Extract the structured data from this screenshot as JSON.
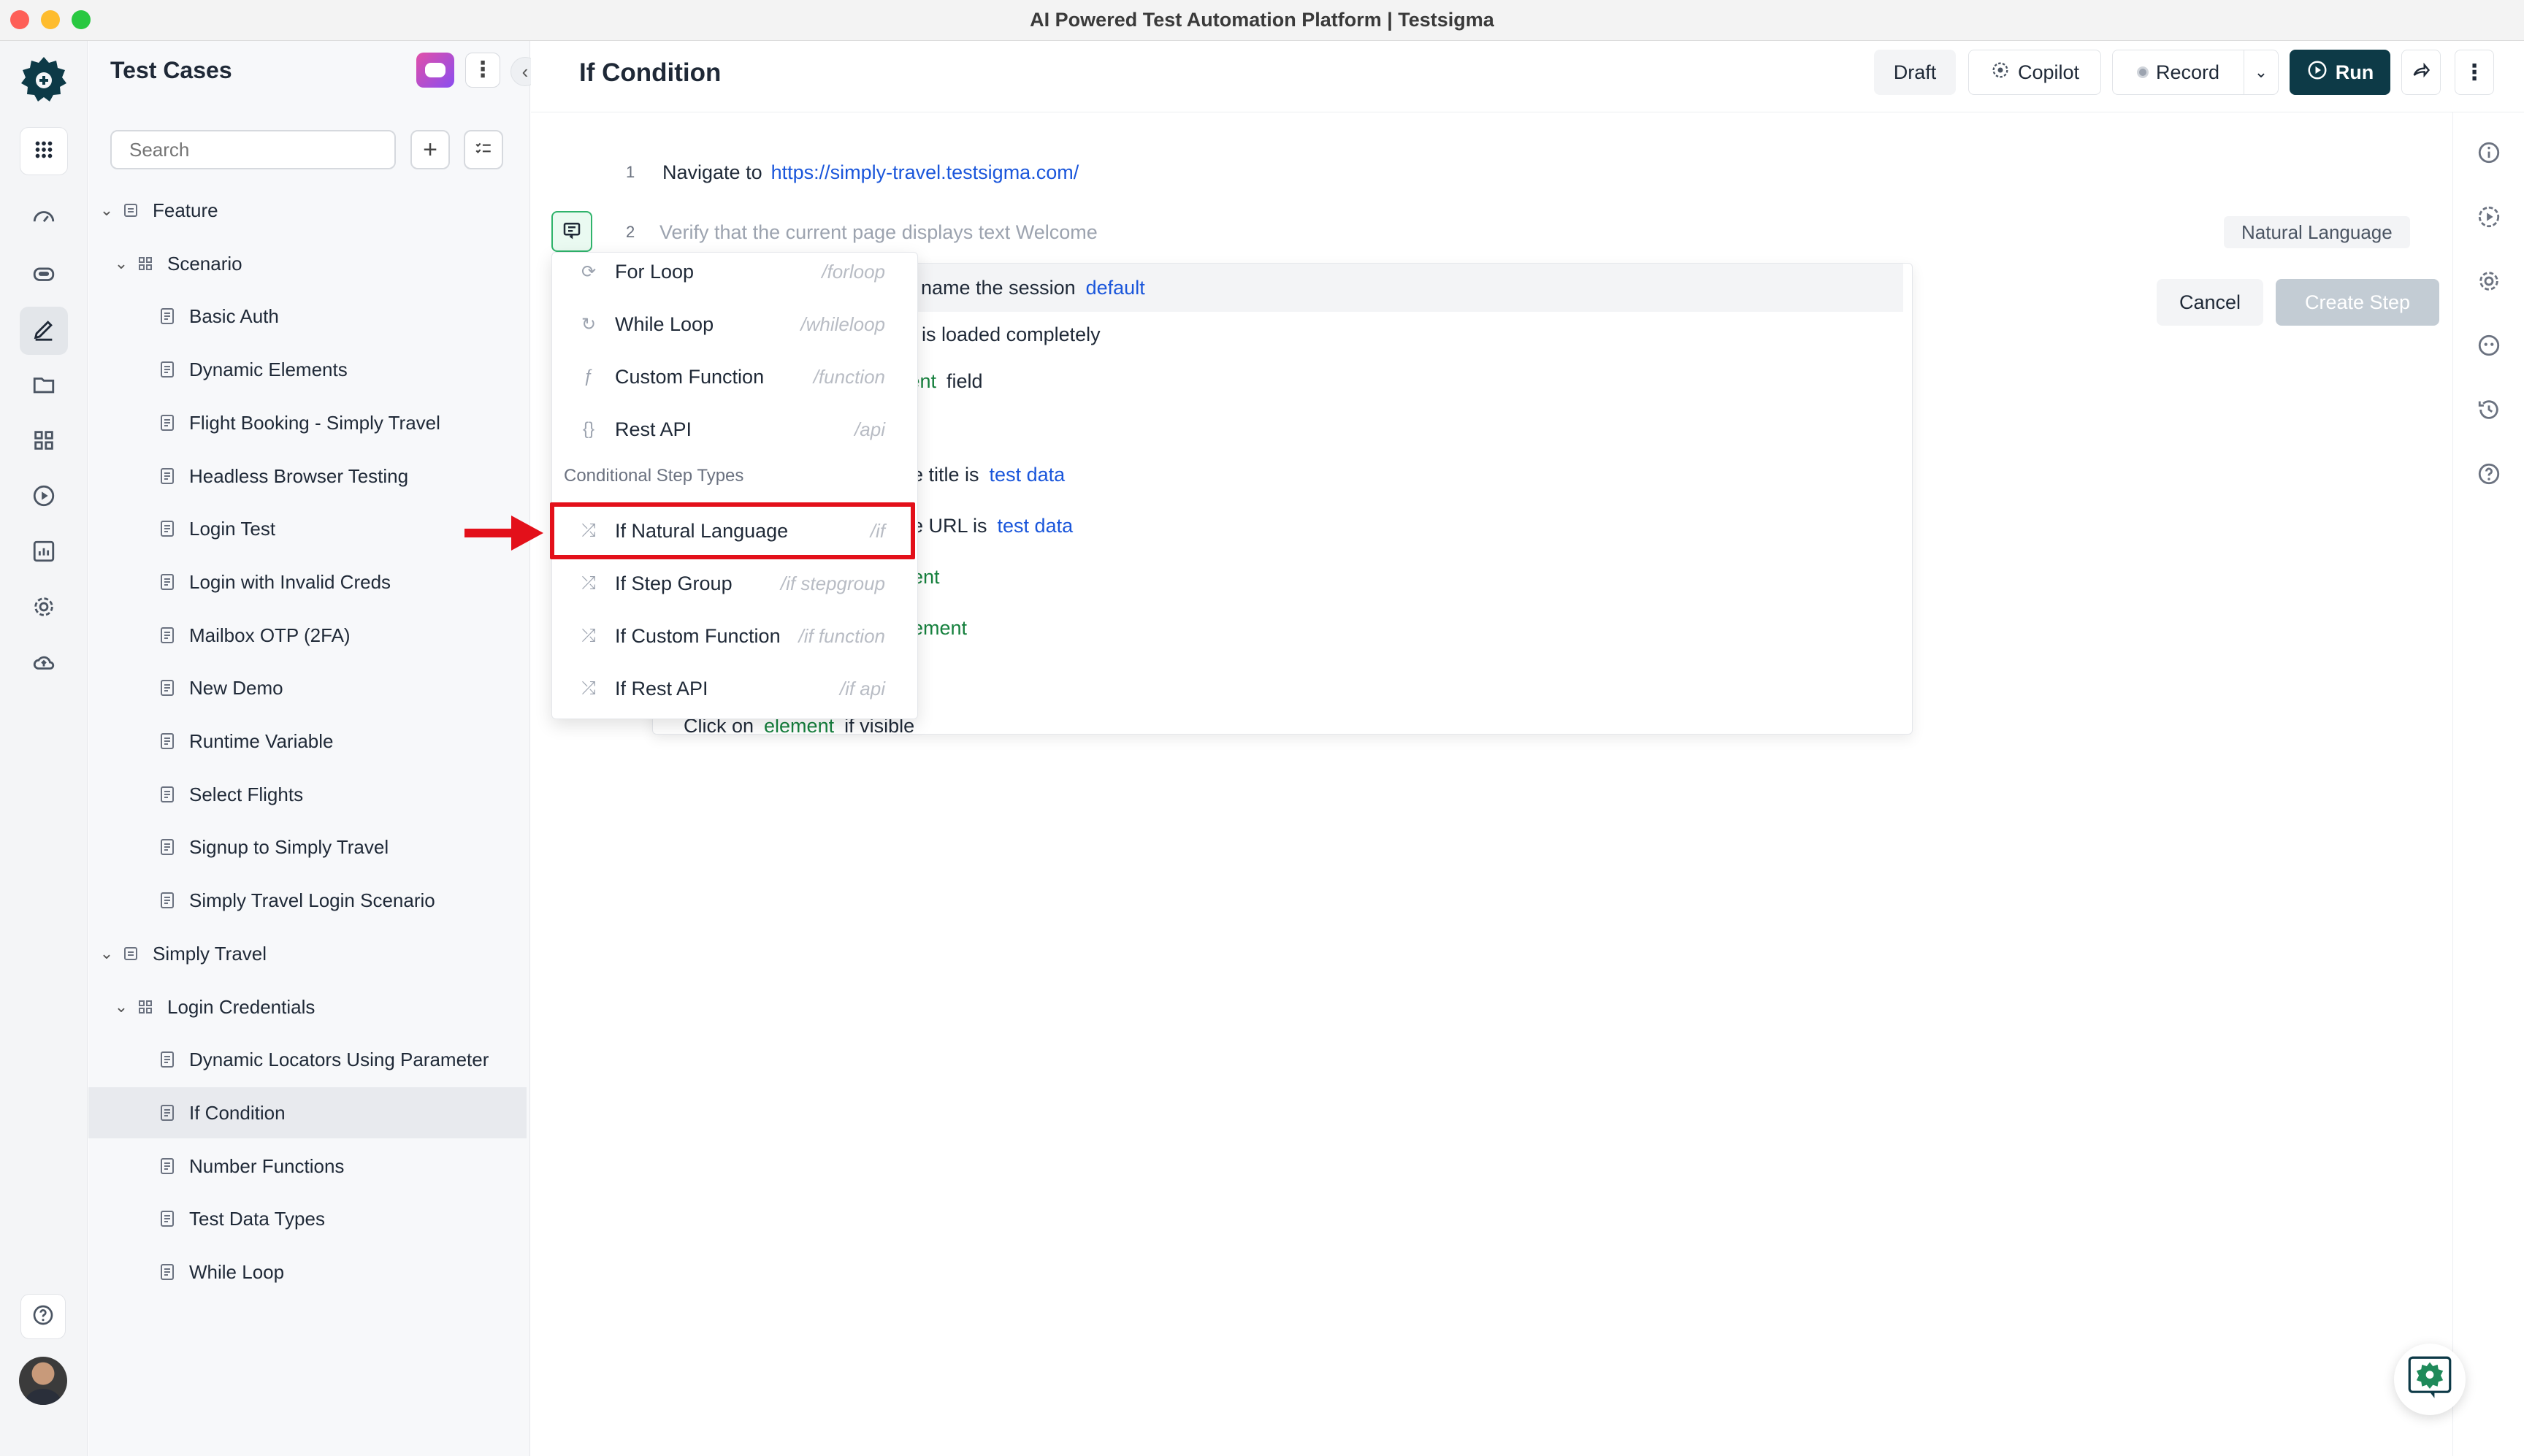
{
  "window": {
    "title": "AI Powered Test Automation Platform | Testsigma"
  },
  "sidebar": {
    "title": "Test Cases",
    "search_placeholder": "Search",
    "tree": [
      {
        "label": "Feature",
        "level": 0,
        "kind": "folder",
        "expanded": true
      },
      {
        "label": "Scenario",
        "level": 1,
        "kind": "scenario",
        "expanded": true
      },
      {
        "label": "Basic Auth",
        "level": 2,
        "kind": "case"
      },
      {
        "label": "Dynamic Elements",
        "level": 2,
        "kind": "case"
      },
      {
        "label": "Flight Booking - Simply Travel",
        "level": 2,
        "kind": "case"
      },
      {
        "label": "Headless Browser Testing",
        "level": 2,
        "kind": "case"
      },
      {
        "label": "Login Test",
        "level": 2,
        "kind": "case"
      },
      {
        "label": "Login with Invalid Creds",
        "level": 2,
        "kind": "case"
      },
      {
        "label": "Mailbox OTP (2FA)",
        "level": 2,
        "kind": "case"
      },
      {
        "label": "New Demo",
        "level": 2,
        "kind": "case"
      },
      {
        "label": "Runtime Variable",
        "level": 2,
        "kind": "case"
      },
      {
        "label": "Select Flights",
        "level": 2,
        "kind": "case"
      },
      {
        "label": "Signup to Simply Travel",
        "level": 2,
        "kind": "case"
      },
      {
        "label": "Simply Travel Login Scenario",
        "level": 2,
        "kind": "case"
      },
      {
        "label": "Simply Travel",
        "level": 0,
        "kind": "folder",
        "expanded": true
      },
      {
        "label": "Login Credentials",
        "level": 1,
        "kind": "scenario",
        "expanded": true
      },
      {
        "label": "Dynamic Locators Using Parameter",
        "level": 2,
        "kind": "case"
      },
      {
        "label": "If Condition",
        "level": 2,
        "kind": "case",
        "selected": true
      },
      {
        "label": "Number Functions",
        "level": 2,
        "kind": "case"
      },
      {
        "label": "Test Data Types",
        "level": 2,
        "kind": "case"
      },
      {
        "label": "While Loop",
        "level": 2,
        "kind": "case"
      }
    ]
  },
  "header": {
    "title": "If Condition",
    "draft_label": "Draft",
    "copilot_label": "Copilot",
    "record_label": "Record",
    "run_label": "Run"
  },
  "steps": [
    {
      "number": "1",
      "text": "Navigate to",
      "url": "https://simply-travel.testsigma.com/"
    },
    {
      "number": "2",
      "text": "Verify that the current page displays text Welcome",
      "type_badge": "Natural Language"
    }
  ],
  "editor": {
    "cancel_label": "Cancel",
    "create_label": "Create Step"
  },
  "suggestions": [
    {
      "segments": [
        {
          "t": "name the session",
          "c": "plain"
        },
        {
          "t": "default",
          "c": "blue"
        }
      ]
    },
    {
      "segments": [
        {
          "t": "is loaded completely",
          "c": "plain"
        }
      ]
    },
    {
      "segments": [
        {
          "t": "ment",
          "c": "green"
        },
        {
          "t": "field",
          "c": "plain"
        }
      ]
    },
    {
      "segments": [
        {
          "t": "",
          "c": "plain"
        }
      ]
    },
    {
      "segments": [
        {
          "t": "e title is",
          "c": "plain"
        },
        {
          "t": "test data",
          "c": "blue"
        }
      ]
    },
    {
      "segments": [
        {
          "t": "e URL is",
          "c": "plain"
        },
        {
          "t": "test data",
          "c": "blue"
        }
      ]
    },
    {
      "segments": [
        {
          "t": "ent",
          "c": "green"
        }
      ]
    },
    {
      "segments": [
        {
          "t": "ement",
          "c": "green"
        }
      ]
    },
    {
      "segments": [
        {
          "t": "",
          "c": "plain"
        }
      ]
    },
    {
      "segments": [
        {
          "t": "Click on",
          "c": "plain"
        },
        {
          "t": "element",
          "c": "green"
        },
        {
          "t": "if visible",
          "c": "plain"
        }
      ]
    }
  ],
  "menu": {
    "items_top": [
      {
        "label": "For Loop",
        "shortcut": "/forloop",
        "icon": "loop-icon"
      },
      {
        "label": "While Loop",
        "shortcut": "/whileloop",
        "icon": "while-loop-icon"
      },
      {
        "label": "Custom Function",
        "shortcut": "/function",
        "icon": "function-icon"
      },
      {
        "label": "Rest API",
        "shortcut": "/api",
        "icon": "api-icon"
      }
    ],
    "section_label": "Conditional Step Types",
    "items_conditional": [
      {
        "label": "If Natural Language",
        "shortcut": "/if",
        "icon": "shuffle-icon"
      },
      {
        "label": "If Step Group",
        "shortcut": "/if stepgroup",
        "icon": "shuffle-icon"
      },
      {
        "label": "If Custom Function",
        "shortcut": "/if function",
        "icon": "shuffle-icon"
      },
      {
        "label": "If Rest API",
        "shortcut": "/if api",
        "icon": "shuffle-icon"
      }
    ]
  },
  "colors": {
    "primary": "#0d3a47",
    "accent_red": "#e3101a",
    "link_blue": "#1a56db",
    "element_green": "#15803d"
  }
}
